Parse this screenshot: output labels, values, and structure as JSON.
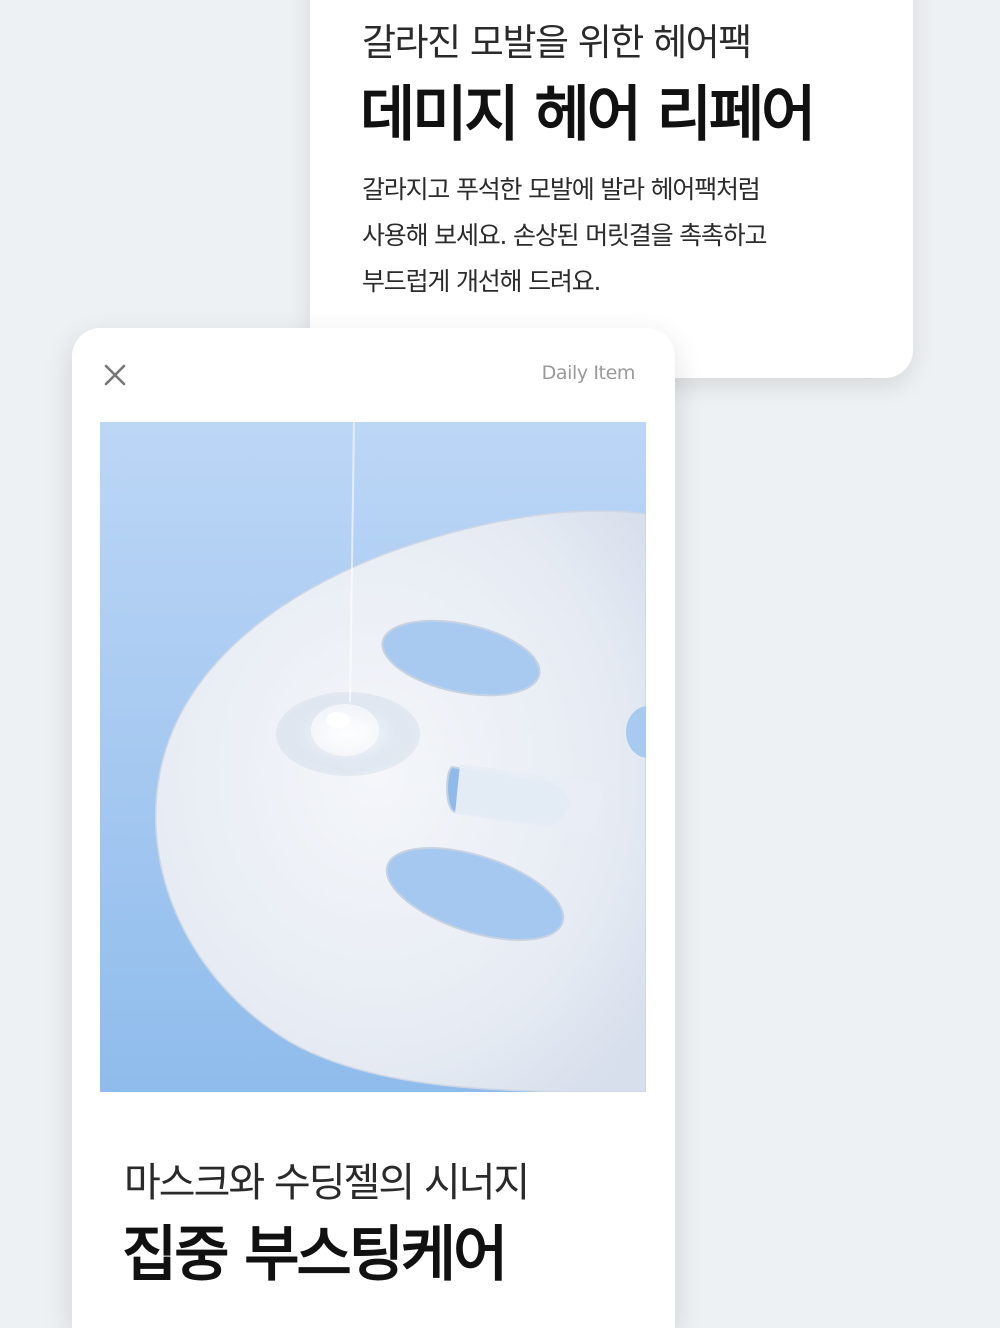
{
  "product_card": {
    "subtitle": "갈라진 모발을 위한 헤어팩",
    "title": "데미지 헤어 리페어",
    "description_lines": [
      "갈라지고 푸석한 모발에 발라 헤어팩처럼",
      "사용해 보세요. 손상된 머릿결을 촉촉하고",
      "부드럽게 개선해 드려요."
    ]
  },
  "item_card": {
    "close_icon": "close-icon",
    "tag": "Daily Item",
    "image": "sheet-mask-with-gel-photo",
    "subtitle": "마스크와 수딩젤의 시너지",
    "title": "집중 부스팅케어"
  },
  "colors": {
    "page_background": "#eef1f3",
    "card_background": "#ffffff",
    "photo_background": "#a9cbf2",
    "tag_text": "#9a9a9a"
  }
}
